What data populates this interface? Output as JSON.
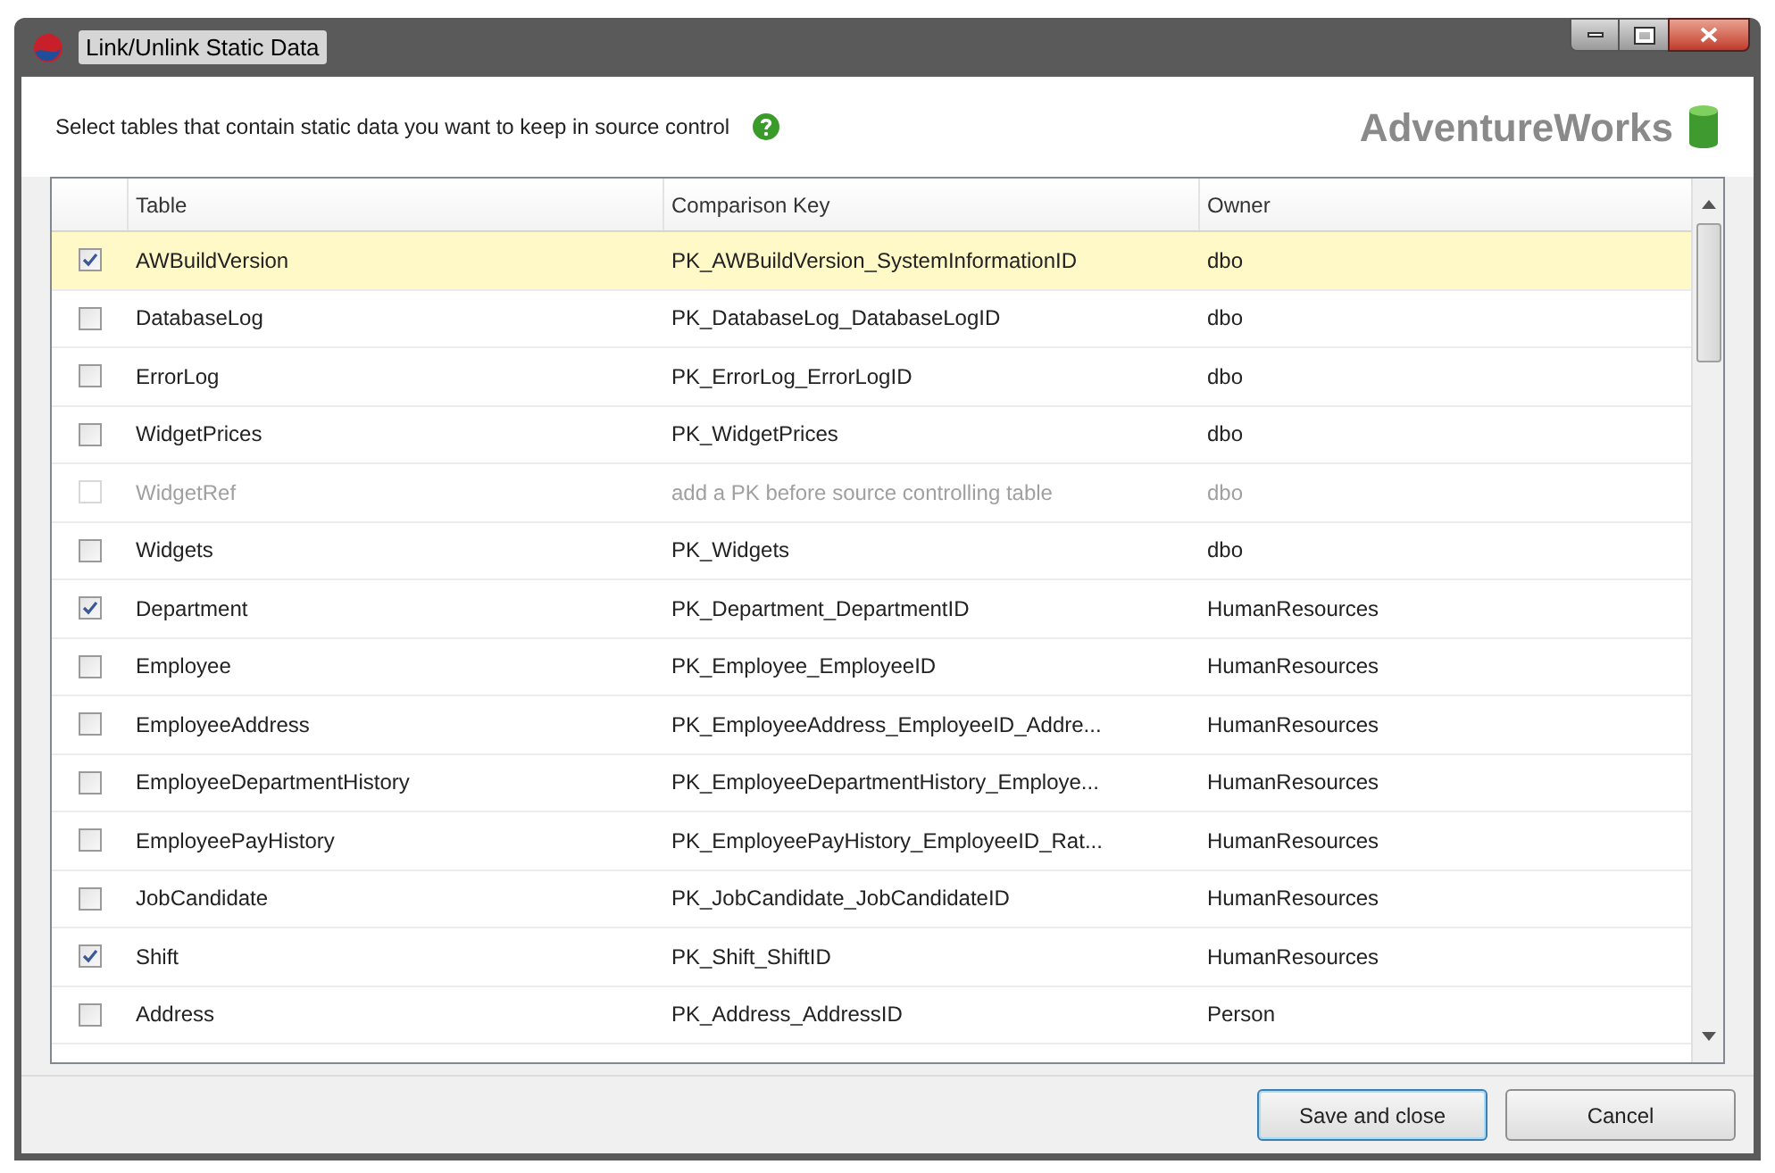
{
  "window": {
    "title": "Link/Unlink Static Data"
  },
  "instruction": "Select tables that contain static data you want to keep in source control",
  "database": "AdventureWorks",
  "table": {
    "columns": [
      "Table",
      "Comparison Key",
      "Owner"
    ],
    "rows": [
      {
        "checked": true,
        "selected": true,
        "disabled": false,
        "cells": [
          "AWBuildVersion",
          "PK_AWBuildVersion_SystemInformationID",
          "dbo"
        ]
      },
      {
        "checked": false,
        "selected": false,
        "disabled": false,
        "cells": [
          "DatabaseLog",
          "PK_DatabaseLog_DatabaseLogID",
          "dbo"
        ]
      },
      {
        "checked": false,
        "selected": false,
        "disabled": false,
        "cells": [
          "ErrorLog",
          "PK_ErrorLog_ErrorLogID",
          "dbo"
        ]
      },
      {
        "checked": false,
        "selected": false,
        "disabled": false,
        "cells": [
          "WidgetPrices",
          "PK_WidgetPrices",
          "dbo"
        ]
      },
      {
        "checked": false,
        "selected": false,
        "disabled": true,
        "cells": [
          "WidgetRef",
          "add a PK before source controlling table",
          "dbo"
        ]
      },
      {
        "checked": false,
        "selected": false,
        "disabled": false,
        "cells": [
          "Widgets",
          "PK_Widgets",
          "dbo"
        ]
      },
      {
        "checked": true,
        "selected": false,
        "disabled": false,
        "cells": [
          "Department",
          "PK_Department_DepartmentID",
          "HumanResources"
        ]
      },
      {
        "checked": false,
        "selected": false,
        "disabled": false,
        "cells": [
          "Employee",
          "PK_Employee_EmployeeID",
          "HumanResources"
        ]
      },
      {
        "checked": false,
        "selected": false,
        "disabled": false,
        "cells": [
          "EmployeeAddress",
          "PK_EmployeeAddress_EmployeeID_Addre...",
          "HumanResources"
        ]
      },
      {
        "checked": false,
        "selected": false,
        "disabled": false,
        "cells": [
          "EmployeeDepartmentHistory",
          "PK_EmployeeDepartmentHistory_Employe...",
          "HumanResources"
        ]
      },
      {
        "checked": false,
        "selected": false,
        "disabled": false,
        "cells": [
          "EmployeePayHistory",
          "PK_EmployeePayHistory_EmployeeID_Rat...",
          "HumanResources"
        ]
      },
      {
        "checked": false,
        "selected": false,
        "disabled": false,
        "cells": [
          "JobCandidate",
          "PK_JobCandidate_JobCandidateID",
          "HumanResources"
        ]
      },
      {
        "checked": true,
        "selected": false,
        "disabled": false,
        "cells": [
          "Shift",
          "PK_Shift_ShiftID",
          "HumanResources"
        ]
      },
      {
        "checked": false,
        "selected": false,
        "disabled": false,
        "cells": [
          "Address",
          "PK_Address_AddressID",
          "Person"
        ]
      }
    ]
  },
  "buttons": [
    "Save and close",
    "Cancel"
  ]
}
